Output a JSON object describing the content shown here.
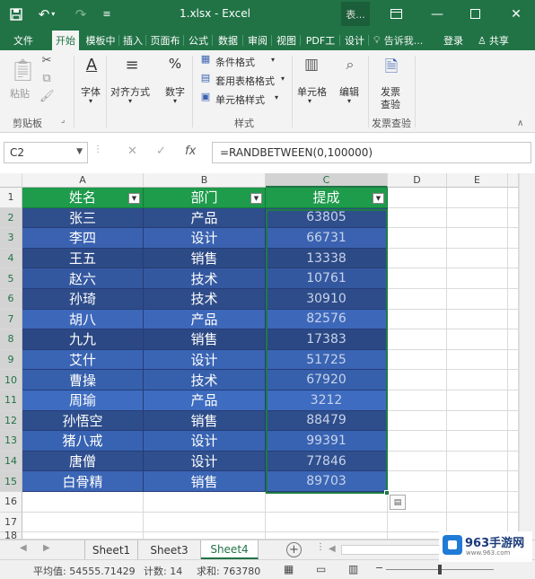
{
  "window": {
    "title": "1.xlsx - Excel",
    "mode_box": "表..."
  },
  "ribbon_tabs": [
    "文件",
    "开始",
    "模板中",
    "插入",
    "页面布",
    "公式",
    "数据",
    "审阅",
    "视图",
    "PDF工",
    "设计"
  ],
  "active_tab": "开始",
  "tellme": "告诉我...",
  "login": "登录",
  "share": "共享",
  "ribbon": {
    "paste": "粘贴",
    "clipboard": "剪贴板",
    "font": "字体",
    "alignment": "对齐方式",
    "number": "数字",
    "conditional_format": "条件格式",
    "table_format": "套用表格格式",
    "cell_styles": "单元格样式",
    "styles": "样式",
    "cells": "单元格",
    "edit": "编辑",
    "invoice_check_line1": "发票",
    "invoice_check_line2": "查验",
    "invoice_check_group": "发票查验"
  },
  "formula_bar": {
    "name_box": "C2",
    "formula": "=RANDBETWEEN(0,100000)"
  },
  "columns": [
    "A",
    "B",
    "C",
    "D",
    "E"
  ],
  "rows": [
    "1",
    "2",
    "3",
    "4",
    "5",
    "6",
    "7",
    "8",
    "9",
    "10",
    "11",
    "12",
    "13",
    "14",
    "15",
    "16",
    "17",
    "18"
  ],
  "table": {
    "headers": [
      "姓名",
      "部门",
      "提成"
    ],
    "data": [
      [
        "张三",
        "产品",
        "63805"
      ],
      [
        "李四",
        "设计",
        "66731"
      ],
      [
        "王五",
        "销售",
        "13338"
      ],
      [
        "赵六",
        "技术",
        "10761"
      ],
      [
        "孙琦",
        "技术",
        "30910"
      ],
      [
        "胡八",
        "产品",
        "82576"
      ],
      [
        "九九",
        "销售",
        "17383"
      ],
      [
        "艾什",
        "设计",
        "51725"
      ],
      [
        "曹操",
        "技术",
        "67920"
      ],
      [
        "周瑜",
        "产品",
        "3212"
      ],
      [
        "孙悟空",
        "销售",
        "88479"
      ],
      [
        "猪八戒",
        "设计",
        "99391"
      ],
      [
        "唐僧",
        "设计",
        "77846"
      ],
      [
        "白骨精",
        "销售",
        "89703"
      ]
    ],
    "row_colors": [
      "#2f4e8c",
      "#3a62b0",
      "#2c4a86",
      "#3458a0",
      "#2e4c8a",
      "#3d68ba",
      "#2b4884",
      "#3a64b4",
      "#3660ac",
      "#3e6cc0",
      "#2e4d8b",
      "#3863b2",
      "#2f4f8e",
      "#3b66b6"
    ],
    "header_color": "#1e9b4b",
    "selection_color": "#1e7b45"
  },
  "sheets": [
    "Sheet1",
    "Sheet3",
    "Sheet4"
  ],
  "active_sheet": "Sheet4",
  "status": {
    "average": "平均值: 54555.71429",
    "count": "计数: 14",
    "sum": "求和: 763780"
  },
  "watermark": {
    "brand": "963手游网",
    "url": "www.963.com"
  }
}
